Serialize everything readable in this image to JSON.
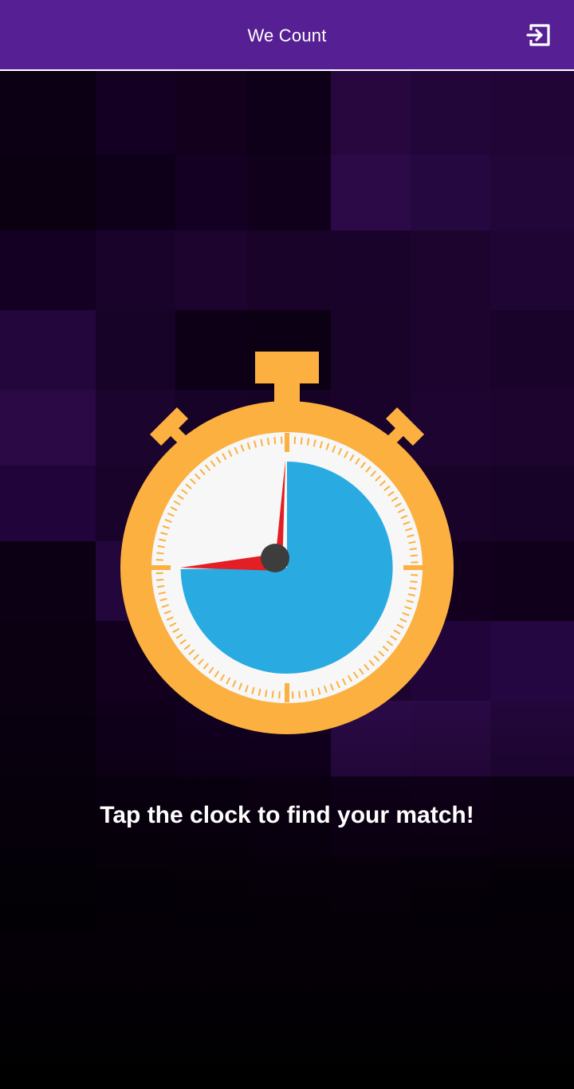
{
  "app_bar": {
    "title": "We Count",
    "background": "#561f93",
    "logout_icon": "exit-to-app-icon"
  },
  "main": {
    "stopwatch_icon": "stopwatch-icon",
    "stopwatch_colors": {
      "body": "#fbb040",
      "face": "#f7f7f7",
      "progress": "#29abe2",
      "hands": "#e31e24",
      "pivot": "#3d3d3d"
    },
    "prompt": "Tap the clock to find your match!"
  },
  "background": {
    "base": "#0f0018",
    "accent": "#2b0a47"
  }
}
